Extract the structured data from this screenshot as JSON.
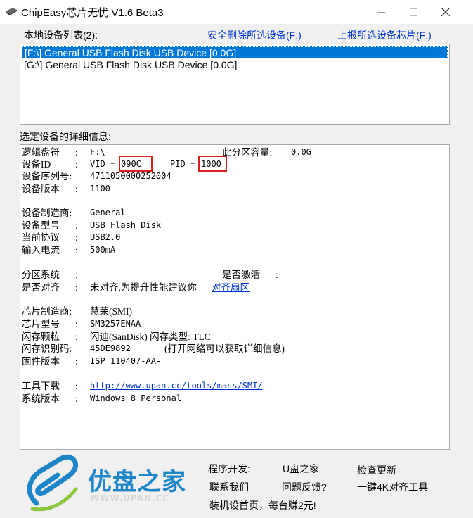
{
  "window": {
    "title": "ChipEasy芯片无忧 V1.6 Beta3",
    "min_glyph": "—",
    "max_glyph": "☐",
    "close_glyph": "✕"
  },
  "devices": {
    "heading": "本地设备列表(2):",
    "safe_remove_link": "安全删除所选设备(F:)",
    "report_link": "上报所选设备芯片(F:)",
    "items": [
      {
        "label": "[F:\\] General USB Flash Disk USB Device [0.0G]",
        "selected": true
      },
      {
        "label": "[G:\\] General USB Flash Disk USB Device [0.0G]",
        "selected": false
      }
    ]
  },
  "details": {
    "heading": "选定设备的详细信息:",
    "logical_drive_label": "逻辑盘符",
    "logical_drive_sep": ":",
    "logical_drive_value": "F:\\",
    "partition_capacity_label": "此分区容量:",
    "partition_capacity_value": "0.0G",
    "device_id_label": "设备ID",
    "device_id_sep": ":",
    "vid_label": "VID =",
    "vid_value": "090C",
    "pid_label": "PID =",
    "pid_value": "1000",
    "serial_label": "设备序列号:",
    "serial_value": "4711050000252004",
    "version_label": "设备版本",
    "version_sep": ":",
    "version_value": "1100",
    "manufacturer_label": "设备制造商:",
    "manufacturer_value": "General",
    "model_label": "设备型号",
    "model_sep": ":",
    "model_value": "USB Flash Disk",
    "protocol_label": "当前协议",
    "protocol_sep": ":",
    "protocol_value": "USB2.0",
    "current_label": "输入电流",
    "current_sep": ":",
    "current_value": "500mA",
    "partition_system_label": "分区系统",
    "partition_system_sep": ":",
    "activated_label": "是否激活",
    "activated_sep": ":",
    "aligned_label": "是否对齐",
    "aligned_sep": ":",
    "aligned_value": "未对齐,为提升性能建议你",
    "aligned_link": "对齐扇区",
    "chip_maker_label": "芯片制造商:",
    "chip_maker_value": "慧荣(SMI)",
    "chip_model_label": "芯片型号",
    "chip_model_sep": ":",
    "chip_model_value": "SM3257ENAA",
    "flash_label": "闪存颗粒",
    "flash_sep": ":",
    "flash_value": "闪迪(SanDisk) 闪存类型: TLC",
    "flash_id_label": "闪存识别码:",
    "flash_id_value": "45DE9892",
    "flash_id_note": "(打开网络可以获取详细信息)",
    "firmware_label": "固件版本",
    "firmware_sep": ":",
    "firmware_value": "ISP 110407-AA-",
    "tool_label": "工具下载",
    "tool_sep": ":",
    "tool_link": "http://www.upan.cc/tools/mass/SMI/",
    "os_label": "系统版本",
    "os_sep": ":",
    "os_value": "Windows 8 Personal"
  },
  "footer": {
    "logo_text": "优盘之家",
    "logo_sub": "WWW.UPAN.CC",
    "developer": "程序开发:",
    "home": "U盘之家",
    "check_update": "检查更新",
    "contact": "联系我们",
    "feedback": "问题反馈?",
    "align_tool": "一键4K对齐工具",
    "promo": "装机设首页，每台赚2元!"
  },
  "colors": {
    "selection": "#0078d7",
    "link": "#0033cc",
    "highlight_box": "#e02020",
    "logo_blue": "#1d86c8"
  }
}
